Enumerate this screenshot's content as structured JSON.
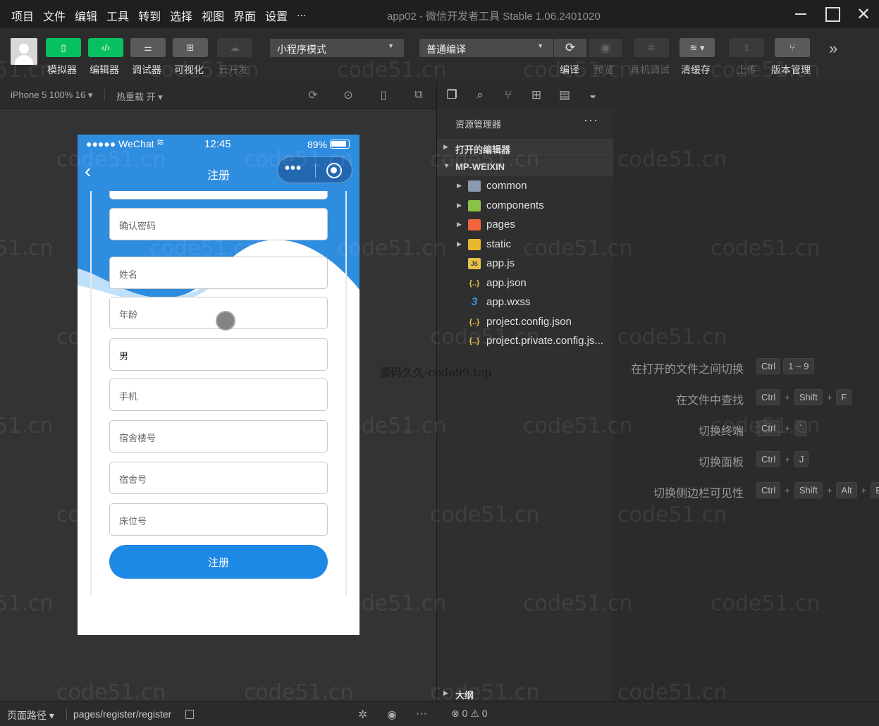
{
  "menu": [
    "项目",
    "文件",
    "编辑",
    "工具",
    "转到",
    "选择",
    "视图",
    "界面",
    "设置",
    "..."
  ],
  "window_title": "app02 - 微信开发者工具 Stable 1.06.2401020",
  "toolbar": {
    "simulator": "模拟器",
    "editor": "编辑器",
    "debugger": "调试器",
    "visual": "可视化",
    "cloud": "云开发",
    "mode_select": "小程序模式",
    "compile_select": "普通编译",
    "compile": "编译",
    "preview": "预览",
    "real_debug": "真机调试",
    "clear_cache": "清缓存",
    "upload": "上传",
    "version": "版本管理"
  },
  "simbar": {
    "device": "iPhone 5 100% 16",
    "hot_reload": "热重载 开"
  },
  "phone": {
    "carrier": "●●●●● WeChat",
    "time": "12:45",
    "battery": "89%",
    "nav_title": "注册",
    "fields": [
      {
        "text": "确认密码",
        "filled": false
      },
      {
        "text": "姓名",
        "filled": false
      },
      {
        "text": "年龄",
        "filled": false
      },
      {
        "text": "男",
        "filled": true
      },
      {
        "text": "手机",
        "filled": false
      },
      {
        "text": "宿舍楼号",
        "filled": false
      },
      {
        "text": "宿舍号",
        "filled": false
      },
      {
        "text": "床位号",
        "filled": false
      }
    ],
    "register_button": "注册"
  },
  "explorer": {
    "title": "资源管理器",
    "open_editors": "打开的编辑器",
    "project": "MP-WEIXIN",
    "files": [
      {
        "name": "common",
        "type": "folder-gray",
        "icon": "folder-icon"
      },
      {
        "name": "components",
        "type": "folder-green",
        "icon": "folder-icon"
      },
      {
        "name": "pages",
        "type": "folder-red",
        "icon": "folder-icon"
      },
      {
        "name": "static",
        "type": "folder-yellow",
        "icon": "folder-icon"
      },
      {
        "name": "app.js",
        "type": "js",
        "icon": "js-file-icon"
      },
      {
        "name": "app.json",
        "type": "json",
        "icon": "json-file-icon"
      },
      {
        "name": "app.wxss",
        "type": "css",
        "icon": "css-file-icon"
      },
      {
        "name": "project.config.json",
        "type": "json",
        "icon": "json-file-icon"
      },
      {
        "name": "project.private.config.js...",
        "type": "json",
        "icon": "json-file-icon"
      }
    ],
    "outline": "大纲"
  },
  "editor": {
    "center_text": "源码久久-code99.top",
    "shortcuts": [
      {
        "label": "在打开的文件之间切换",
        "keys": [
          "Ctrl",
          "1 ~ 9"
        ]
      },
      {
        "label": "在文件中查找",
        "keys": [
          "Ctrl",
          "Shift",
          "F"
        ]
      },
      {
        "label": "切换终端",
        "keys": [
          "Ctrl",
          "`"
        ]
      },
      {
        "label": "切换面板",
        "keys": [
          "Ctrl",
          "J"
        ]
      },
      {
        "label": "切换侧边栏可见性",
        "keys": [
          "Ctrl",
          "Shift",
          "Alt",
          "B"
        ]
      }
    ]
  },
  "statusbar": {
    "page_path_label": "页面路径",
    "page_path": "pages/register/register",
    "errors": "0",
    "warnings": "0"
  },
  "watermark": "code51.cn",
  "colors": {
    "wechat_green": "#07c160",
    "nav_blue": "#2f8de0",
    "button_blue": "#1e88e5"
  }
}
